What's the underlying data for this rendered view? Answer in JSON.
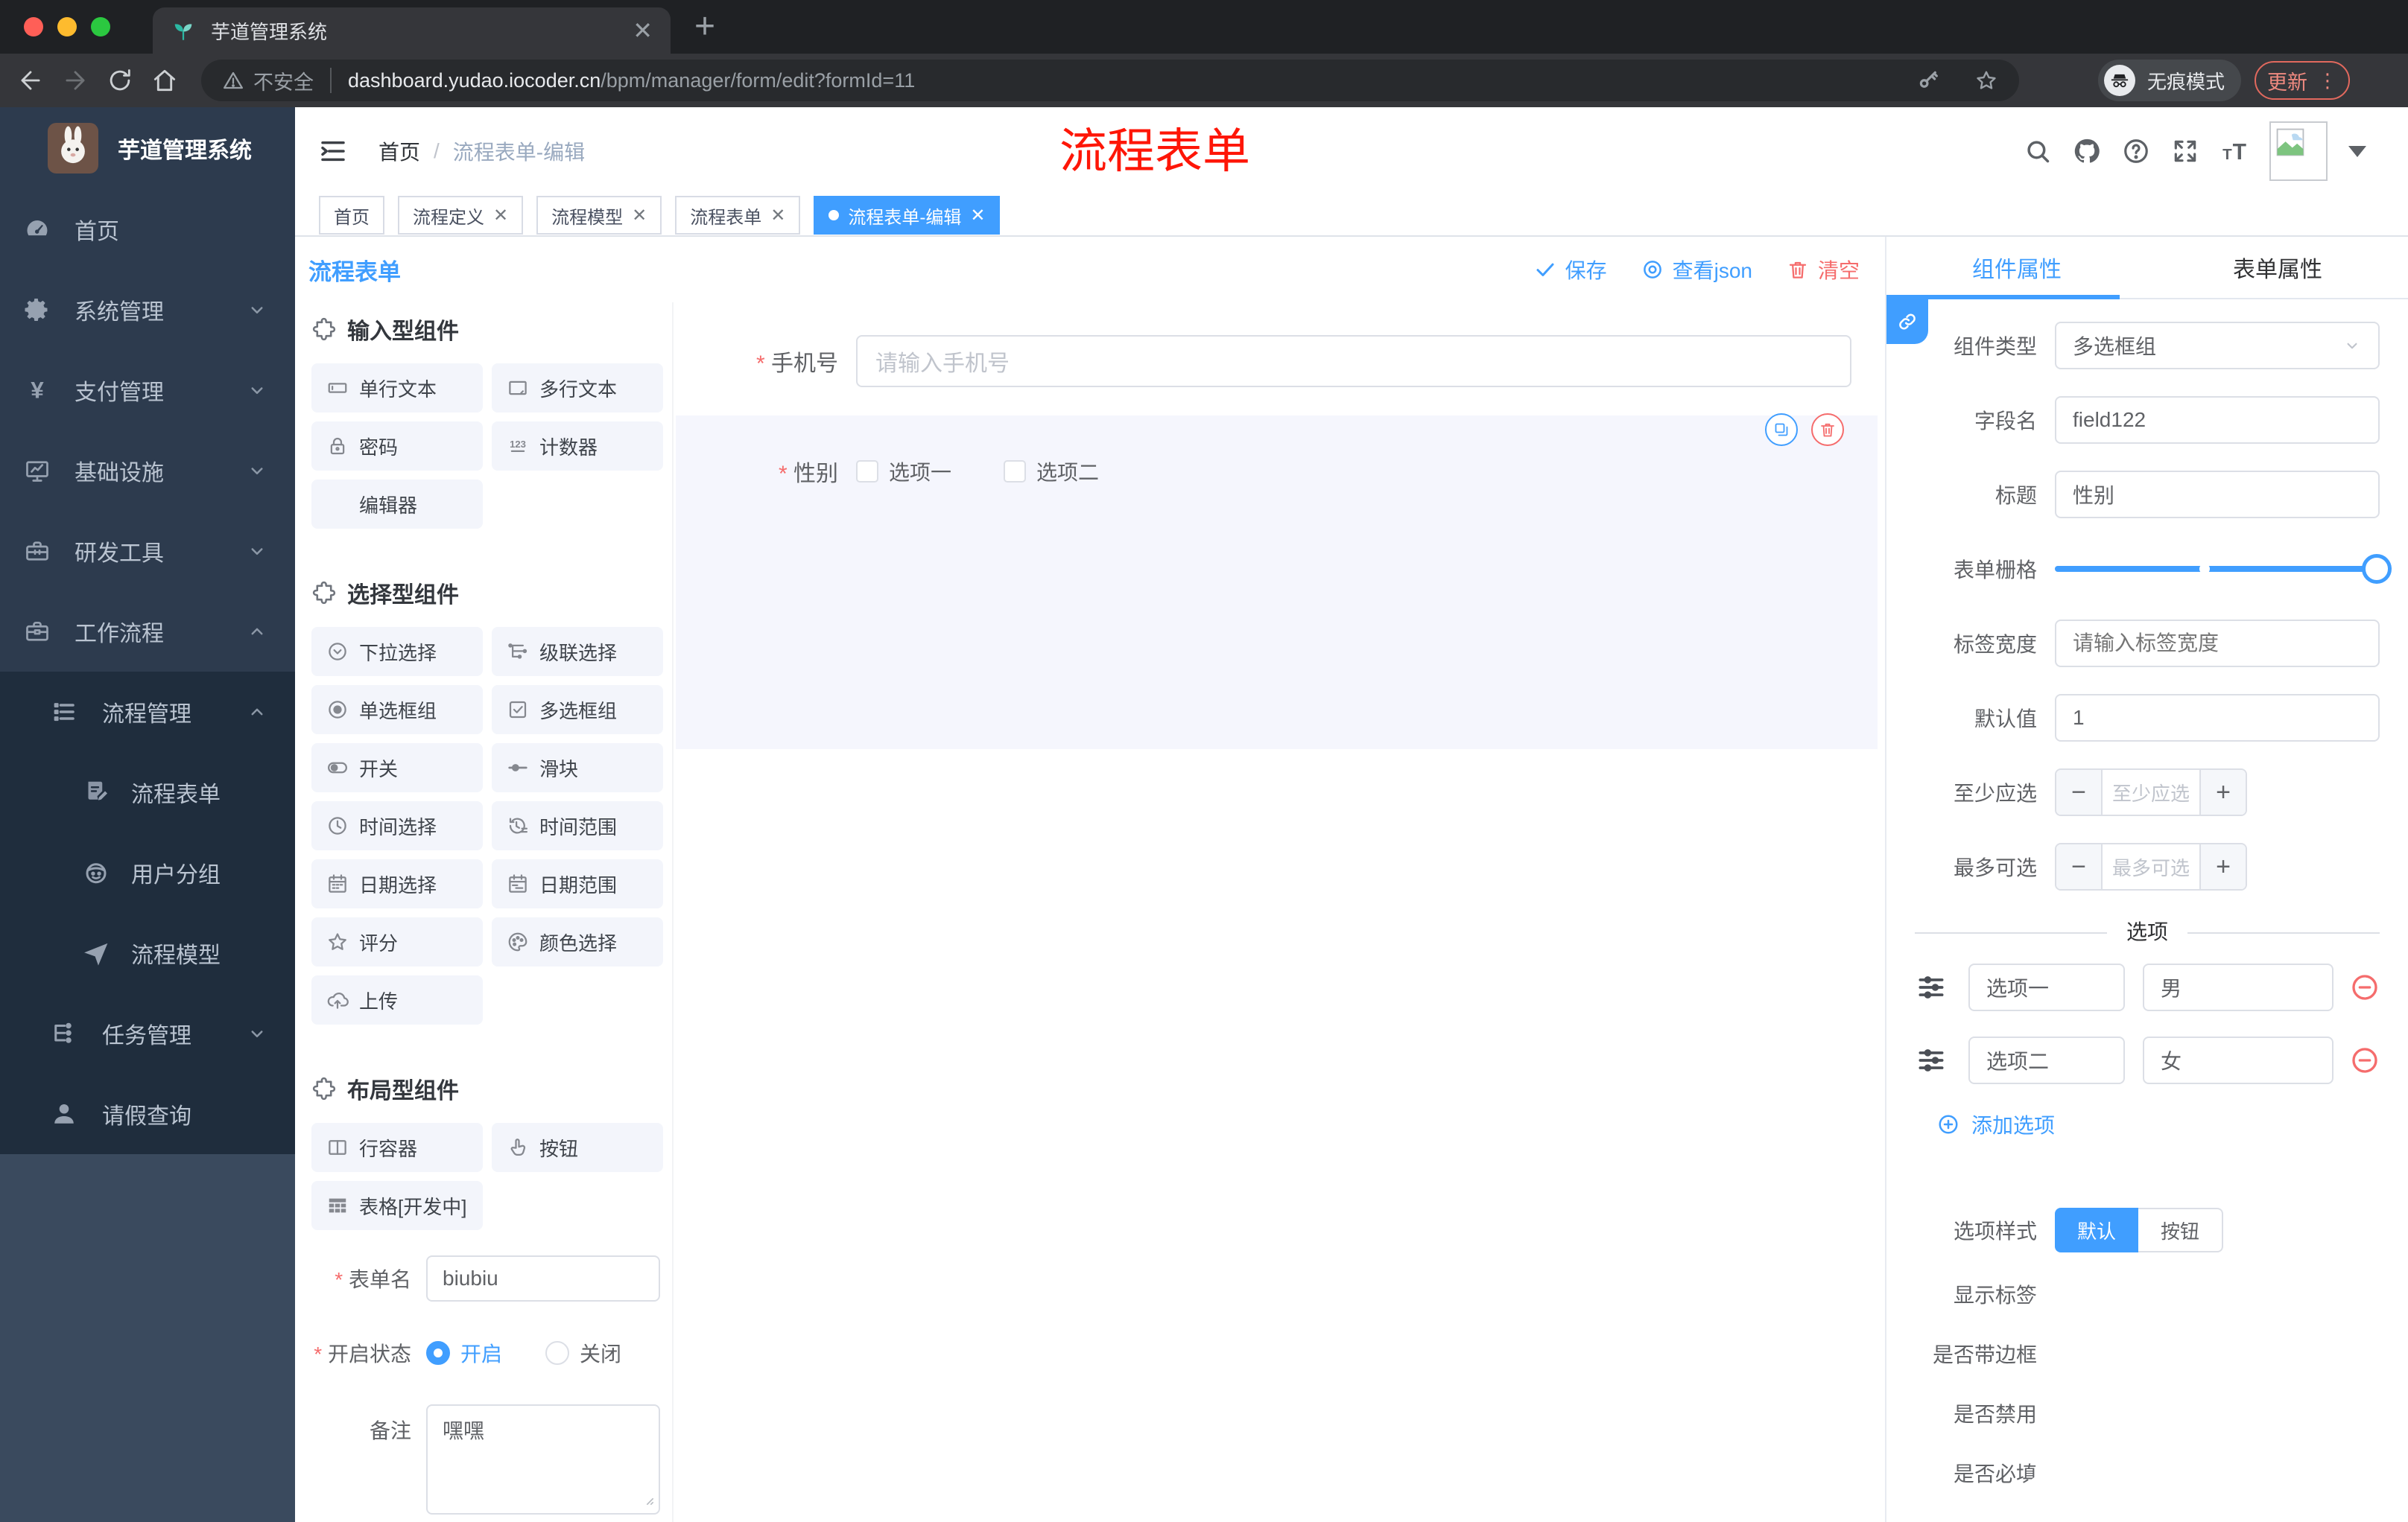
{
  "colors": {
    "accent": "#409eff",
    "danger": "#f56c6c",
    "annotation": "#fe1607",
    "sidebar_bg": "#2d3b4e",
    "submenu_bg": "#1f2d3d"
  },
  "browser": {
    "tab_title": "芋道管理系统",
    "security_label": "不安全",
    "url_host": "dashboard.yudao.iocoder.cn",
    "url_path": "/bpm/manager/form/edit?formId=11",
    "incognito_label": "无痕模式",
    "update_label": "更新"
  },
  "sidebar": {
    "logo_title": "芋道管理系统",
    "items": [
      {
        "id": "home",
        "label": "首页",
        "icon": "dashboard",
        "level": 1,
        "chevron": null,
        "group": "top"
      },
      {
        "id": "system-mgmt",
        "label": "系统管理",
        "icon": "gear",
        "level": 1,
        "chevron": "down",
        "group": "top"
      },
      {
        "id": "payment-mgmt",
        "label": "支付管理",
        "icon": "yen",
        "level": 1,
        "chevron": "down",
        "group": "top"
      },
      {
        "id": "infrastructure",
        "label": "基础设施",
        "icon": "monitor",
        "level": 1,
        "chevron": "down",
        "group": "top"
      },
      {
        "id": "dev-tools",
        "label": "研发工具",
        "icon": "toolbox",
        "level": 1,
        "chevron": "down",
        "group": "top"
      },
      {
        "id": "workflow",
        "label": "工作流程",
        "icon": "briefcase",
        "level": 1,
        "chevron": "up",
        "group": "top"
      },
      {
        "id": "process-mgmt",
        "label": "流程管理",
        "icon": "listtree",
        "level": 2,
        "chevron": "up",
        "group": "sub"
      },
      {
        "id": "process-form",
        "label": "流程表单",
        "icon": "docedit",
        "level": 3,
        "chevron": null,
        "group": "sub"
      },
      {
        "id": "user-group",
        "label": "用户分组",
        "icon": "robot",
        "level": 3,
        "chevron": null,
        "group": "sub"
      },
      {
        "id": "process-model",
        "label": "流程模型",
        "icon": "send",
        "level": 3,
        "chevron": null,
        "group": "sub"
      },
      {
        "id": "task-mgmt",
        "label": "任务管理",
        "icon": "tree",
        "level": 2,
        "chevron": "down",
        "group": "sub"
      },
      {
        "id": "leave-query",
        "label": "请假查询",
        "icon": "user",
        "level": 2,
        "chevron": null,
        "group": "sub"
      }
    ]
  },
  "header": {
    "breadcrumb": [
      "首页",
      "流程表单-编辑"
    ],
    "annotation": "流程表单"
  },
  "tags": [
    {
      "id": "home",
      "label": "首页",
      "closable": false,
      "active": false
    },
    {
      "id": "process-definition",
      "label": "流程定义",
      "closable": true,
      "active": false
    },
    {
      "id": "process-model",
      "label": "流程模型",
      "closable": true,
      "active": false
    },
    {
      "id": "process-form",
      "label": "流程表单",
      "closable": true,
      "active": false
    },
    {
      "id": "process-form-edit",
      "label": "流程表单-编辑",
      "closable": true,
      "active": true
    }
  ],
  "actionbar": {
    "title": "流程表单",
    "buttons": [
      {
        "id": "save",
        "label": "保存",
        "icon": "check",
        "color": "blue"
      },
      {
        "id": "view-json",
        "label": "查看json",
        "icon": "eyering",
        "color": "blue"
      },
      {
        "id": "clear",
        "label": "清空",
        "icon": "trash",
        "color": "red"
      }
    ]
  },
  "library": {
    "groups": [
      {
        "title": "输入型组件",
        "items": [
          {
            "id": "single-line-text",
            "label": "单行文本",
            "icon": "inputbox"
          },
          {
            "id": "multi-line-text",
            "label": "多行文本",
            "icon": "textareabox"
          },
          {
            "id": "password",
            "label": "密码",
            "icon": "lock"
          },
          {
            "id": "counter",
            "label": "计数器",
            "icon": "counter"
          },
          {
            "id": "editor",
            "label": "编辑器",
            "icon": null
          }
        ]
      },
      {
        "title": "选择型组件",
        "items": [
          {
            "id": "select",
            "label": "下拉选择",
            "icon": "selectcircle"
          },
          {
            "id": "cascader",
            "label": "级联选择",
            "icon": "cascade"
          },
          {
            "id": "radio-group",
            "label": "单选框组",
            "icon": "radio"
          },
          {
            "id": "checkbox-group",
            "label": "多选框组",
            "icon": "checkboxsq"
          },
          {
            "id": "switch",
            "label": "开关",
            "icon": "switch"
          },
          {
            "id": "slider",
            "label": "滑块",
            "icon": "sliderline"
          },
          {
            "id": "time-picker",
            "label": "时间选择",
            "icon": "clock"
          },
          {
            "id": "time-range",
            "label": "时间范围",
            "icon": "clockrange"
          },
          {
            "id": "date-picker",
            "label": "日期选择",
            "icon": "calendar"
          },
          {
            "id": "date-range",
            "label": "日期范围",
            "icon": "calendarrange"
          },
          {
            "id": "rate",
            "label": "评分",
            "icon": "star"
          },
          {
            "id": "color-picker",
            "label": "颜色选择",
            "icon": "palette"
          },
          {
            "id": "upload",
            "label": "上传",
            "icon": "upload"
          }
        ]
      },
      {
        "title": "布局型组件",
        "items": [
          {
            "id": "row-container",
            "label": "行容器",
            "icon": "columns"
          },
          {
            "id": "button",
            "label": "按钮",
            "icon": "hand"
          },
          {
            "id": "table",
            "label": "表格[开发中]",
            "icon": "tablegrid"
          }
        ]
      }
    ]
  },
  "left_form": {
    "form_name_label": "表单名",
    "form_name_value": "biubiu",
    "status_label": "开启状态",
    "status_on": "开启",
    "status_off": "关闭",
    "remark_label": "备注",
    "remark_value": "嘿嘿"
  },
  "canvas": {
    "phone_label": "手机号",
    "phone_placeholder": "请输入手机号",
    "gender_label": "性别",
    "gender_options": [
      "选项一",
      "选项二"
    ]
  },
  "inspector": {
    "tabs": [
      "组件属性",
      "表单属性"
    ],
    "component_type_label": "组件类型",
    "component_type_value": "多选框组",
    "field_name_label": "字段名",
    "field_name_value": "field122",
    "title_label": "标题",
    "title_value": "性别",
    "grid_label": "表单栅格",
    "label_width_label": "标签宽度",
    "label_width_placeholder": "请输入标签宽度",
    "default_label": "默认值",
    "default_value": "1",
    "min_label": "至少应选",
    "min_placeholder": "至少应选",
    "max_label": "最多可选",
    "max_placeholder": "最多可选",
    "options_divider": "选项",
    "options": [
      {
        "label": "选项一",
        "value": "男"
      },
      {
        "label": "选项二",
        "value": "女"
      }
    ],
    "add_option": "添加选项",
    "option_style_label": "选项样式",
    "option_style_values": [
      "默认",
      "按钮"
    ],
    "option_style_selected": "默认",
    "switches": [
      {
        "id": "show-label",
        "label": "显示标签",
        "on": true
      },
      {
        "id": "border",
        "label": "是否带边框",
        "on": false
      },
      {
        "id": "disabled",
        "label": "是否禁用",
        "on": false
      },
      {
        "id": "required",
        "label": "是否必填",
        "on": true
      }
    ]
  }
}
